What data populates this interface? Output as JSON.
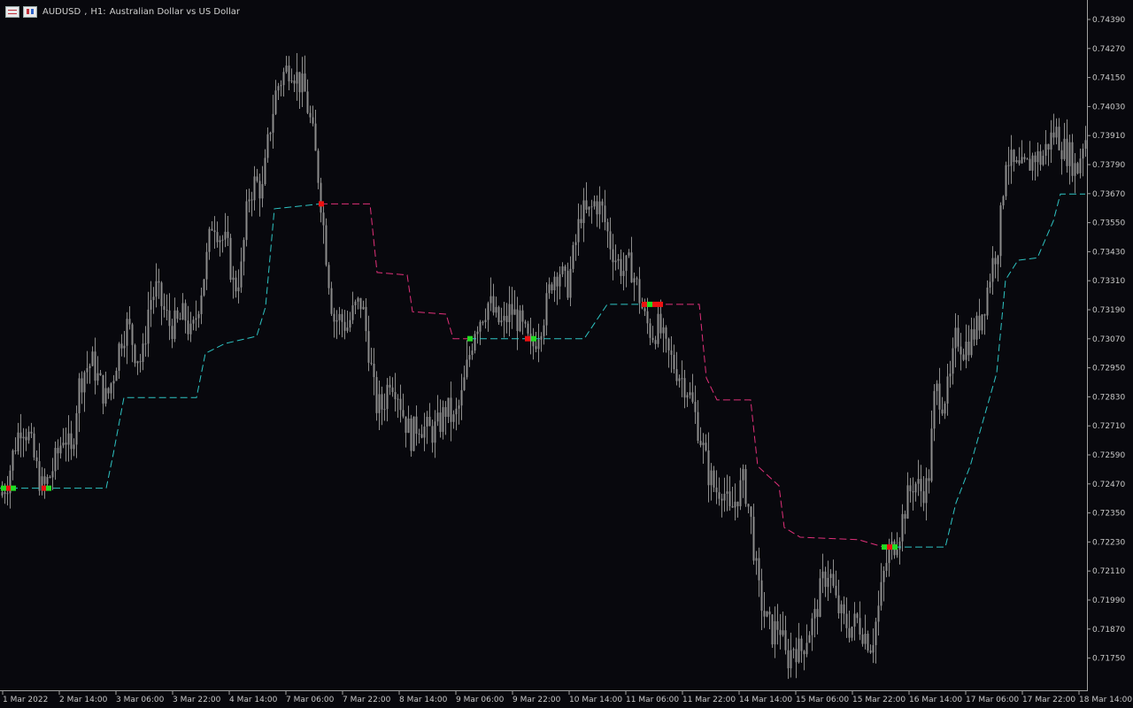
{
  "header": {
    "symbol": "AUDUSD",
    "timeframe": "H1:",
    "description": "Australian Dollar vs US Dollar"
  },
  "colors": {
    "background": "#08080d",
    "axis": "#a0a0a0",
    "candle": "#8c8c8c",
    "trail_up": "#2ec4c4",
    "trail_down": "#e0307a",
    "marker_buy": "#22dd22",
    "marker_sell": "#ee1111"
  },
  "chart_data": {
    "type": "candlestick",
    "price_axis_ticks": [
      "0.74390",
      "0.74270",
      "0.74150",
      "0.74030",
      "0.73910",
      "0.73790",
      "0.73670",
      "0.73550",
      "0.73430",
      "0.73310",
      "0.73190",
      "0.73070",
      "0.72950",
      "0.72830",
      "0.72710",
      "0.72590",
      "0.72470",
      "0.72350",
      "0.72230",
      "0.72110",
      "0.71990",
      "0.71870",
      "0.71750"
    ],
    "ylim": [
      0.7168,
      0.7446
    ],
    "time_axis_labels": [
      "1 Mar 2022",
      "2 Mar 14:00",
      "3 Mar 06:00",
      "3 Mar 22:00",
      "4 Mar 14:00",
      "7 Mar 06:00",
      "7 Mar 22:00",
      "8 Mar 14:00",
      "9 Mar 06:00",
      "9 Mar 22:00",
      "10 Mar 14:00",
      "11 Mar 06:00",
      "11 Mar 22:00",
      "14 Mar 14:00",
      "15 Mar 06:00",
      "15 Mar 22:00",
      "16 Mar 14:00",
      "17 Mar 06:00",
      "17 Mar 22:00",
      "18 Mar 14:00"
    ],
    "close_path": [
      [
        0,
        0.7246
      ],
      [
        8,
        0.7252
      ],
      [
        16,
        0.7266
      ],
      [
        24,
        0.7276
      ],
      [
        32,
        0.727
      ],
      [
        40,
        0.7258
      ],
      [
        48,
        0.7248
      ],
      [
        56,
        0.7254
      ],
      [
        64,
        0.7262
      ],
      [
        72,
        0.7272
      ],
      [
        80,
        0.7262
      ],
      [
        88,
        0.729
      ],
      [
        96,
        0.7298
      ],
      [
        104,
        0.73
      ],
      [
        112,
        0.7292
      ],
      [
        120,
        0.7285
      ],
      [
        128,
        0.7296
      ],
      [
        136,
        0.731
      ],
      [
        144,
        0.7316
      ],
      [
        152,
        0.7305
      ],
      [
        160,
        0.73
      ],
      [
        168,
        0.7325
      ],
      [
        176,
        0.733
      ],
      [
        184,
        0.7322
      ],
      [
        192,
        0.7315
      ],
      [
        200,
        0.7316
      ],
      [
        208,
        0.732
      ],
      [
        216,
        0.731
      ],
      [
        224,
        0.7325
      ],
      [
        232,
        0.734
      ],
      [
        240,
        0.736
      ],
      [
        248,
        0.7352
      ],
      [
        256,
        0.7348
      ],
      [
        264,
        0.733
      ],
      [
        272,
        0.7338
      ],
      [
        280,
        0.7368
      ],
      [
        288,
        0.7374
      ],
      [
        296,
        0.737
      ],
      [
        304,
        0.7395
      ],
      [
        312,
        0.7412
      ],
      [
        320,
        0.7418
      ],
      [
        328,
        0.7422
      ],
      [
        336,
        0.7416
      ],
      [
        344,
        0.741
      ],
      [
        352,
        0.7395
      ],
      [
        360,
        0.7374
      ],
      [
        368,
        0.7345
      ],
      [
        376,
        0.7318
      ],
      [
        384,
        0.7318
      ],
      [
        392,
        0.7315
      ],
      [
        400,
        0.7322
      ],
      [
        408,
        0.7325
      ],
      [
        416,
        0.7306
      ],
      [
        424,
        0.7283
      ],
      [
        432,
        0.7282
      ],
      [
        440,
        0.7295
      ],
      [
        448,
        0.729
      ],
      [
        456,
        0.7278
      ],
      [
        464,
        0.727
      ],
      [
        472,
        0.7276
      ],
      [
        480,
        0.7273
      ],
      [
        488,
        0.7272
      ],
      [
        496,
        0.7275
      ],
      [
        504,
        0.7282
      ],
      [
        512,
        0.7276
      ],
      [
        520,
        0.7284
      ],
      [
        528,
        0.73
      ],
      [
        536,
        0.7315
      ],
      [
        544,
        0.732
      ],
      [
        552,
        0.7325
      ],
      [
        560,
        0.7318
      ],
      [
        568,
        0.7315
      ],
      [
        576,
        0.7322
      ],
      [
        584,
        0.7318
      ],
      [
        592,
        0.7312
      ],
      [
        600,
        0.7305
      ],
      [
        608,
        0.7314
      ],
      [
        616,
        0.7322
      ],
      [
        624,
        0.7336
      ],
      [
        632,
        0.7338
      ],
      [
        640,
        0.733
      ],
      [
        648,
        0.7345
      ],
      [
        656,
        0.7362
      ],
      [
        664,
        0.736
      ],
      [
        672,
        0.7366
      ],
      [
        680,
        0.7362
      ],
      [
        688,
        0.735
      ],
      [
        696,
        0.7342
      ],
      [
        704,
        0.7338
      ],
      [
        712,
        0.734
      ],
      [
        720,
        0.733
      ],
      [
        728,
        0.7318
      ],
      [
        736,
        0.7312
      ],
      [
        744,
        0.7315
      ],
      [
        752,
        0.7305
      ],
      [
        760,
        0.73
      ],
      [
        768,
        0.7295
      ],
      [
        776,
        0.729
      ],
      [
        784,
        0.728
      ],
      [
        792,
        0.7268
      ],
      [
        800,
        0.7255
      ],
      [
        808,
        0.7248
      ],
      [
        816,
        0.725
      ],
      [
        824,
        0.7238
      ],
      [
        832,
        0.7246
      ],
      [
        840,
        0.7252
      ],
      [
        848,
        0.7235
      ],
      [
        856,
        0.7208
      ],
      [
        864,
        0.7196
      ],
      [
        872,
        0.719
      ],
      [
        880,
        0.7194
      ],
      [
        888,
        0.7178
      ],
      [
        896,
        0.7185
      ],
      [
        904,
        0.7182
      ],
      [
        912,
        0.719
      ],
      [
        920,
        0.7196
      ],
      [
        928,
        0.721
      ],
      [
        936,
        0.7216
      ],
      [
        944,
        0.7202
      ],
      [
        952,
        0.7195
      ],
      [
        960,
        0.7192
      ],
      [
        968,
        0.7195
      ],
      [
        976,
        0.719
      ],
      [
        984,
        0.7185
      ],
      [
        992,
        0.72
      ],
      [
        1000,
        0.7218
      ],
      [
        1008,
        0.7225
      ],
      [
        1016,
        0.7232
      ],
      [
        1024,
        0.7244
      ],
      [
        1032,
        0.7252
      ],
      [
        1040,
        0.7248
      ],
      [
        1048,
        0.725
      ],
      [
        1056,
        0.729
      ],
      [
        1064,
        0.7285
      ],
      [
        1072,
        0.729
      ],
      [
        1080,
        0.7312
      ],
      [
        1088,
        0.7306
      ],
      [
        1096,
        0.731
      ],
      [
        1104,
        0.7315
      ],
      [
        1112,
        0.7325
      ],
      [
        1120,
        0.734
      ],
      [
        1128,
        0.735
      ],
      [
        1136,
        0.7385
      ],
      [
        1144,
        0.738
      ],
      [
        1152,
        0.7378
      ],
      [
        1160,
        0.738
      ],
      [
        1168,
        0.7385
      ],
      [
        1176,
        0.7383
      ],
      [
        1184,
        0.739
      ],
      [
        1192,
        0.7395
      ],
      [
        1200,
        0.7388
      ],
      [
        1208,
        0.7385
      ],
      [
        1216,
        0.7378
      ],
      [
        1224,
        0.7392
      ]
    ],
    "trailing_stop": [
      {
        "color": "up",
        "points": [
          [
            0,
            0.7249
          ],
          [
            120,
            0.7249
          ],
          [
            128,
            0.7263
          ],
          [
            140,
            0.7286
          ],
          [
            222,
            0.7286
          ],
          [
            232,
            0.7304
          ],
          [
            254,
            0.7308
          ],
          [
            290,
            0.7311
          ],
          [
            300,
            0.7323
          ],
          [
            310,
            0.7363
          ],
          [
            362,
            0.7365
          ]
        ]
      },
      {
        "color": "down",
        "points": [
          [
            362,
            0.7365
          ],
          [
            418,
            0.7365
          ],
          [
            426,
            0.7337
          ],
          [
            460,
            0.7336
          ],
          [
            466,
            0.7321
          ],
          [
            504,
            0.732
          ],
          [
            512,
            0.731
          ],
          [
            530,
            0.731
          ]
        ]
      },
      {
        "color": "up",
        "points": [
          [
            530,
            0.731
          ],
          [
            660,
            0.731
          ],
          [
            686,
            0.7324
          ],
          [
            728,
            0.7324
          ]
        ]
      },
      {
        "color": "down",
        "points": [
          [
            728,
            0.7324
          ],
          [
            790,
            0.7324
          ],
          [
            798,
            0.7294
          ],
          [
            810,
            0.7285
          ],
          [
            848,
            0.7285
          ],
          [
            856,
            0.7258
          ],
          [
            880,
            0.725
          ],
          [
            886,
            0.7233
          ],
          [
            904,
            0.7229
          ],
          [
            970,
            0.7228
          ],
          [
            998,
            0.7225
          ]
        ]
      },
      {
        "color": "up",
        "points": [
          [
            998,
            0.7225
          ],
          [
            1068,
            0.7225
          ],
          [
            1080,
            0.7243
          ],
          [
            1096,
            0.7258
          ],
          [
            1126,
            0.7296
          ],
          [
            1136,
            0.7334
          ],
          [
            1150,
            0.7342
          ],
          [
            1172,
            0.7343
          ],
          [
            1190,
            0.7358
          ],
          [
            1198,
            0.7369
          ],
          [
            1226,
            0.7369
          ]
        ]
      }
    ],
    "markers": [
      {
        "x": 4,
        "price": 0.7249,
        "kind": "buy"
      },
      {
        "x": 10,
        "price": 0.7249,
        "kind": "sell"
      },
      {
        "x": 15,
        "price": 0.7249,
        "kind": "buy"
      },
      {
        "x": 50,
        "price": 0.7249,
        "kind": "sell"
      },
      {
        "x": 55,
        "price": 0.7249,
        "kind": "buy"
      },
      {
        "x": 363,
        "price": 0.7365,
        "kind": "sell"
      },
      {
        "x": 531,
        "price": 0.731,
        "kind": "buy"
      },
      {
        "x": 596,
        "price": 0.731,
        "kind": "sell"
      },
      {
        "x": 603,
        "price": 0.731,
        "kind": "buy"
      },
      {
        "x": 728,
        "price": 0.7324,
        "kind": "sell"
      },
      {
        "x": 734,
        "price": 0.7324,
        "kind": "buy"
      },
      {
        "x": 740,
        "price": 0.7324,
        "kind": "sell"
      },
      {
        "x": 746,
        "price": 0.7324,
        "kind": "sell"
      },
      {
        "x": 999,
        "price": 0.7225,
        "kind": "buy"
      },
      {
        "x": 1005,
        "price": 0.7225,
        "kind": "sell"
      },
      {
        "x": 1011,
        "price": 0.7225,
        "kind": "buy"
      }
    ]
  }
}
